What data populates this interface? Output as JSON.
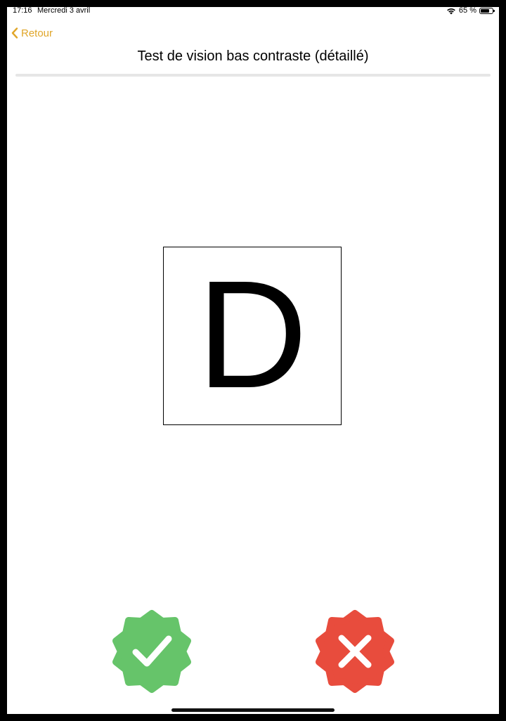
{
  "status_bar": {
    "time": "17:16",
    "date": "Mercredi 3 avril",
    "battery": "65 %",
    "icons": [
      "wifi-icon",
      "battery-icon"
    ]
  },
  "nav": {
    "back_label": "Retour",
    "back_icon": "chevron-left-icon",
    "accent_color": "#e0a62a"
  },
  "page": {
    "title": "Test de vision bas contraste (détaillé)"
  },
  "test": {
    "letter": "D"
  },
  "answers": {
    "yes": {
      "icon": "checkmark-badge-icon",
      "color": "#66c46a"
    },
    "no": {
      "icon": "x-badge-icon",
      "color": "#e84c3d"
    }
  }
}
